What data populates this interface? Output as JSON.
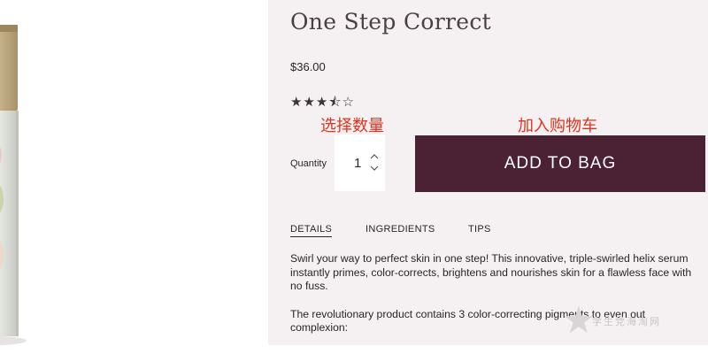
{
  "product": {
    "title": "One Step Correct",
    "price": "$36.00",
    "rating_stars": "★★★⯪☆",
    "rating_value": 3.5,
    "rating_max": 5
  },
  "annotations": {
    "select_quantity": "选择数量",
    "add_to_cart": "加入购物车"
  },
  "quantity": {
    "label": "Quantity",
    "value": "1",
    "up_icon": "chevron-up-icon",
    "down_icon": "chevron-down-icon"
  },
  "add_button": {
    "label": "ADD TO BAG"
  },
  "tabs": [
    {
      "label": "DETAILS",
      "active": true
    },
    {
      "label": "INGREDIENTS",
      "active": false
    },
    {
      "label": "TIPS",
      "active": false
    }
  ],
  "description": {
    "paragraph1": "Swirl your way to perfect skin in one step! This innovative, triple-swirled helix serum instantly primes, color-corrects, brightens and nourishes skin for a flawless face with no fuss.",
    "paragraph2": "The revolutionary product contains 3 color-correcting pigments to even out complexion:"
  },
  "watermark": {
    "text": "学生党海淘网",
    "icon": "star-icon"
  },
  "colors": {
    "button_bg": "#4b2134",
    "panel_bg": "#f5f0f1",
    "annotation": "#e0331f"
  }
}
